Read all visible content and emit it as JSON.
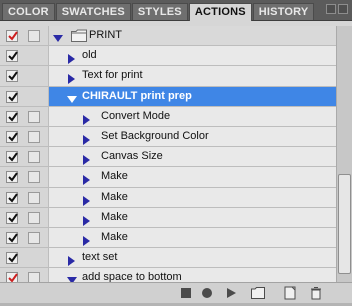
{
  "tabs": [
    "COLOR",
    "SWATCHES",
    "STYLES",
    "ACTIONS",
    "HISTORY"
  ],
  "active_tab": "ACTIONS",
  "rows": [
    {
      "label": "PRINT",
      "kind": "set",
      "expanded": true
    },
    {
      "label": "old",
      "kind": "action"
    },
    {
      "label": "Text for print",
      "kind": "action"
    },
    {
      "label": "CHIRAULT print prep",
      "kind": "action",
      "expanded": true,
      "selected": true
    },
    {
      "label": "Convert Mode",
      "kind": "step"
    },
    {
      "label": "Set Background Color",
      "kind": "step"
    },
    {
      "label": "Canvas Size",
      "kind": "step"
    },
    {
      "label": "Make",
      "kind": "step"
    },
    {
      "label": "Make",
      "kind": "step"
    },
    {
      "label": "Make",
      "kind": "step"
    },
    {
      "label": "Make",
      "kind": "step"
    },
    {
      "label": "text set",
      "kind": "action"
    },
    {
      "label": "add space to bottom",
      "kind": "action",
      "expanded": true
    }
  ],
  "colors": {
    "selection": "#3f86e6",
    "triangle": "#2a2aa6",
    "check_red": "#cc2020",
    "check_black": "#111111"
  },
  "toolbar_icons": [
    "stop-icon",
    "record-icon",
    "play-icon",
    "new-set-icon",
    "new-action-icon",
    "delete-icon"
  ]
}
